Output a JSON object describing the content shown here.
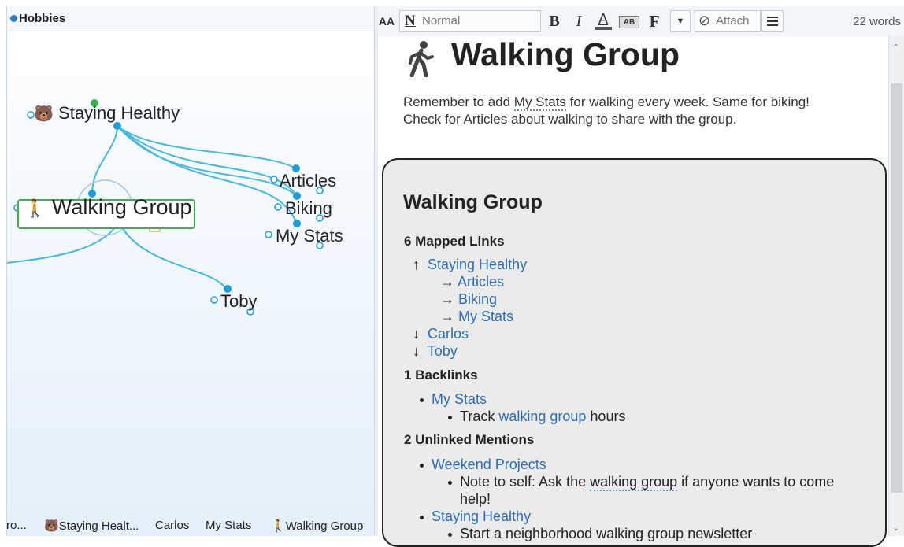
{
  "map": {
    "header_title": "Hobbies",
    "nodes": {
      "staying_healthy": "Staying Healthy",
      "walking_group": "Walking Group",
      "articles": "Articles",
      "biking": "Biking",
      "my_stats": "My Stats",
      "toby": "Toby"
    },
    "tabs": [
      "ro...",
      "Staying Healt...",
      "Carlos",
      "My Stats",
      "Walking Group"
    ],
    "colors": {
      "link": "#4ab8dc",
      "node_dot": "#1e9cd7",
      "green": "#37b24d",
      "selected_border": "#3fae57"
    }
  },
  "toolbar": {
    "font_size_icon": "AA",
    "style_label": "Normal",
    "bold": "B",
    "italic": "I",
    "font_color": "A",
    "highlight": "AB",
    "format": "F",
    "attach_label": "Attach",
    "word_count": "22 words"
  },
  "note": {
    "title": "Walking Group",
    "body_pre": "Remember to add ",
    "body_link": "My Stats",
    "body_post": " for walking every week. Same for biking!",
    "body_line2": "Check for Articles about walking to share with the group."
  },
  "report": {
    "title": "Walking Group",
    "mapped_header": "6 Mapped Links",
    "mapped": {
      "parent_arrow": "↑",
      "parent": "Staying Healthy",
      "jump_arrow": "→",
      "jumps": [
        "Articles",
        "Biking",
        "My Stats"
      ],
      "child_arrow": "↓",
      "children": [
        "Carlos",
        "Toby"
      ]
    },
    "backlinks_header": "1 Backlinks",
    "backlink": "My Stats",
    "backlink_sub_pre": "Track ",
    "backlink_sub_link": "walking group",
    "backlink_sub_post": " hours",
    "unlinked_header": "2 Unlinked Mentions",
    "unlinked_1": "Weekend Projects",
    "unlinked_1_sub_pre": "Note to self: Ask the ",
    "unlinked_1_sub_link": "walking group",
    "unlinked_1_sub_post": " if anyone wants to come",
    "unlinked_1_sub_line2": "help!",
    "unlinked_2": "Staying Healthy",
    "unlinked_2_sub": "Start a neighborhood walking group newsletter"
  }
}
